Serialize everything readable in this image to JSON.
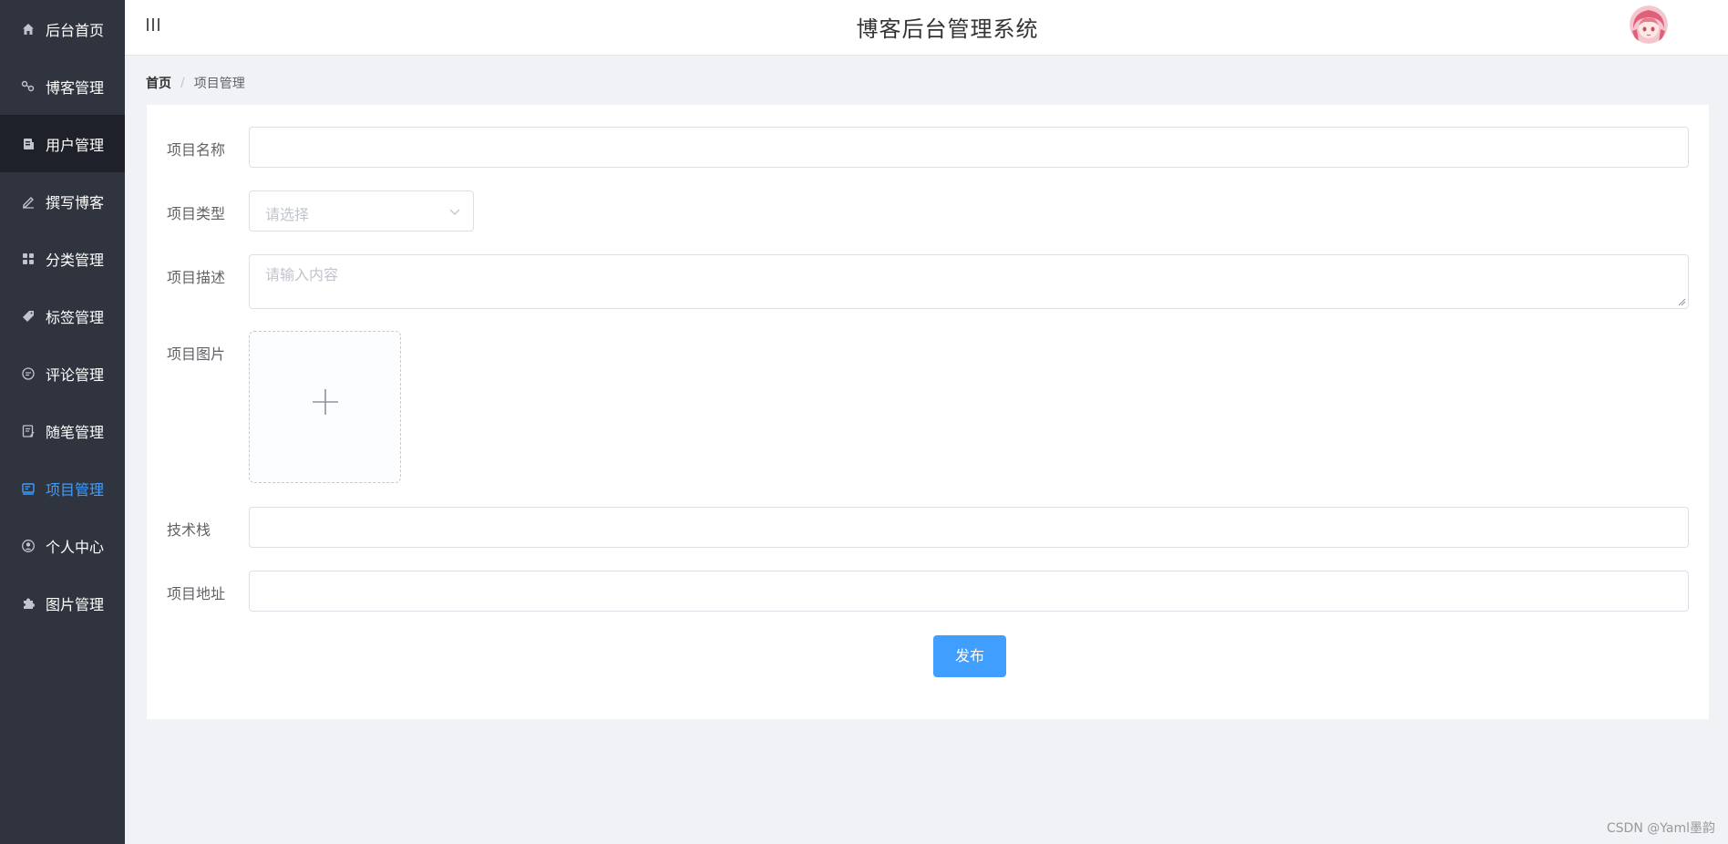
{
  "header": {
    "title": "博客后台管理系统"
  },
  "sidebar": {
    "items": [
      {
        "label": "后台首页",
        "icon": "home-icon"
      },
      {
        "label": "博客管理",
        "icon": "share-icon"
      },
      {
        "label": "用户管理",
        "icon": "user-doc-icon"
      },
      {
        "label": "撰写博客",
        "icon": "pen-icon"
      },
      {
        "label": "分类管理",
        "icon": "grid-icon"
      },
      {
        "label": "标签管理",
        "icon": "tag-icon"
      },
      {
        "label": "评论管理",
        "icon": "comment-icon"
      },
      {
        "label": "随笔管理",
        "icon": "note-icon"
      },
      {
        "label": "项目管理",
        "icon": "project-icon"
      },
      {
        "label": "个人中心",
        "icon": "person-icon"
      },
      {
        "label": "图片管理",
        "icon": "puzzle-icon"
      }
    ],
    "active_index": 8,
    "highlighted_index": 2,
    "active_color": "#409eff",
    "background": "#30343f"
  },
  "breadcrumb": {
    "home": "首页",
    "separator": "/",
    "current": "项目管理"
  },
  "form": {
    "name_label": "项目名称",
    "name_value": "",
    "type_label": "项目类型",
    "type_placeholder": "请选择",
    "desc_label": "项目描述",
    "desc_placeholder": "请输入内容",
    "image_label": "项目图片",
    "stack_label": "技术栈",
    "stack_value": "",
    "url_label": "项目地址",
    "url_value": "",
    "submit_label": "发布"
  },
  "watermark": "CSDN @Yaml墨韵"
}
